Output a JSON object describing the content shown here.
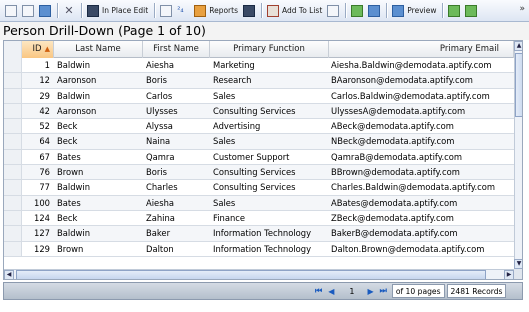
{
  "toolbar": {
    "in_place_edit": "In Place Edit",
    "reports": "Reports",
    "add_to_list": "Add To List",
    "preview": "Preview"
  },
  "title": "Person Drill-Down (Page 1 of 10)",
  "columns": [
    "ID",
    "Last Name",
    "First Name",
    "Primary Function",
    "Primary Email"
  ],
  "rows": [
    {
      "id": "1",
      "last": "Baldwin",
      "first": "Aiesha",
      "function": "Marketing",
      "email": "Aiesha.Baldwin@demodata.aptify.com"
    },
    {
      "id": "12",
      "last": "Aaronson",
      "first": "Boris",
      "function": "Research",
      "email": "BAaronson@demodata.aptify.com"
    },
    {
      "id": "29",
      "last": "Baldwin",
      "first": "Carlos",
      "function": "Sales",
      "email": "Carlos.Baldwin@demodata.aptify.com"
    },
    {
      "id": "42",
      "last": "Aaronson",
      "first": "Ulysses",
      "function": "Consulting Services",
      "email": "UlyssesA@demodata.aptify.com"
    },
    {
      "id": "52",
      "last": "Beck",
      "first": "Alyssa",
      "function": "Advertising",
      "email": "ABeck@demodata.aptify.com"
    },
    {
      "id": "64",
      "last": "Beck",
      "first": "Naina",
      "function": "Sales",
      "email": "NBeck@demodata.aptify.com"
    },
    {
      "id": "67",
      "last": "Bates",
      "first": "Qamra",
      "function": "Customer Support",
      "email": "QamraB@demodata.aptify.com"
    },
    {
      "id": "76",
      "last": "Brown",
      "first": "Boris",
      "function": "Consulting Services",
      "email": "BBrown@demodata.aptify.com"
    },
    {
      "id": "77",
      "last": "Baldwin",
      "first": "Charles",
      "function": "Consulting Services",
      "email": "Charles.Baldwin@demodata.aptify.com"
    },
    {
      "id": "100",
      "last": "Bates",
      "first": "Aiesha",
      "function": "Sales",
      "email": "ABates@demodata.aptify.com"
    },
    {
      "id": "124",
      "last": "Beck",
      "first": "Zahina",
      "function": "Finance",
      "email": "ZBeck@demodata.aptify.com"
    },
    {
      "id": "127",
      "last": "Baldwin",
      "first": "Baker",
      "function": "Information Technology",
      "email": "BakerB@demodata.aptify.com"
    },
    {
      "id": "129",
      "last": "Brown",
      "first": "Dalton",
      "function": "Information Technology",
      "email": "Dalton.Brown@demodata.aptify.com"
    }
  ],
  "pager": {
    "page": "1",
    "pages_label": "of 10 pages",
    "records_label": "2481 Records"
  }
}
